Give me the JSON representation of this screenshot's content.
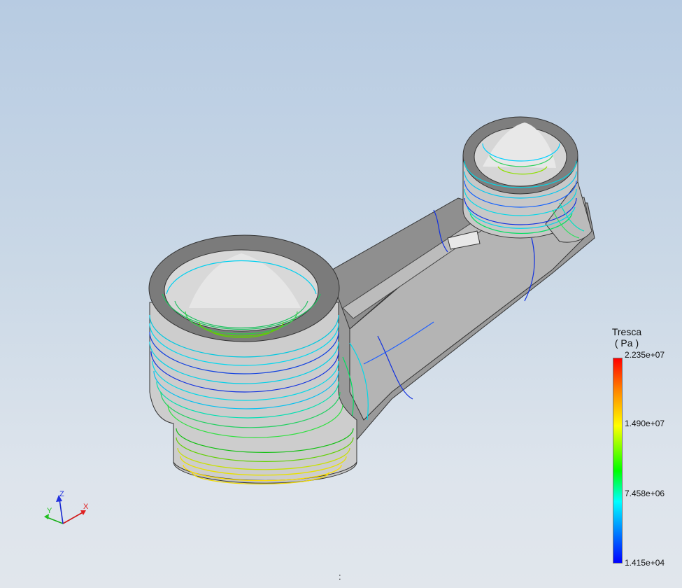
{
  "viewport": {
    "background_top": "#b7cbe2",
    "background_bottom": "#e1e6ec",
    "status_text": ":"
  },
  "legend": {
    "title": "Tresca",
    "unit": "( Pa )",
    "colors": [
      "#ff0000",
      "#ffff00",
      "#00ff00",
      "#00ffff",
      "#0000ff"
    ],
    "max_label": "2.235e+07",
    "tick_2": "1.490e+07",
    "tick_3": "7.458e+06",
    "min_label": "1.415e+04"
  },
  "triad": {
    "x_label": "X",
    "y_label": "Y",
    "z_label": "Z",
    "x_color": "#ff2020",
    "y_color": "#20c020",
    "z_color": "#2030e0"
  }
}
